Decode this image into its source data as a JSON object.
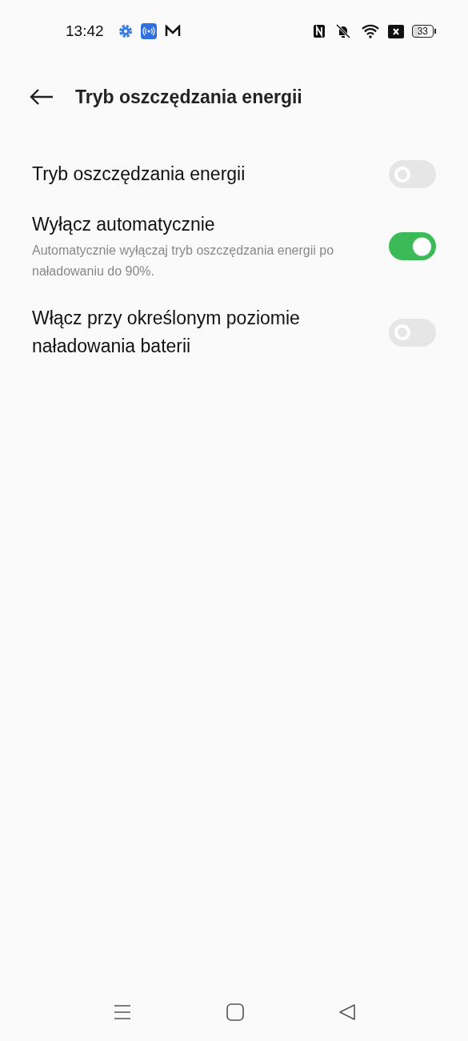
{
  "status_bar": {
    "time": "13:42",
    "battery": "33"
  },
  "header": {
    "title": "Tryb oszczędzania energii"
  },
  "settings": [
    {
      "kind": "toggle",
      "title": "Tryb oszczędzania energii",
      "on": false
    },
    {
      "kind": "toggle",
      "title": "Wyłącz automatycznie",
      "subtitle": "Automatycznie wyłączaj tryb oszczędzania energii po naładowaniu do 90%.",
      "on": true
    },
    {
      "kind": "toggle",
      "title": "Włącz przy określonym poziomie naładowania baterii",
      "on": false
    }
  ]
}
